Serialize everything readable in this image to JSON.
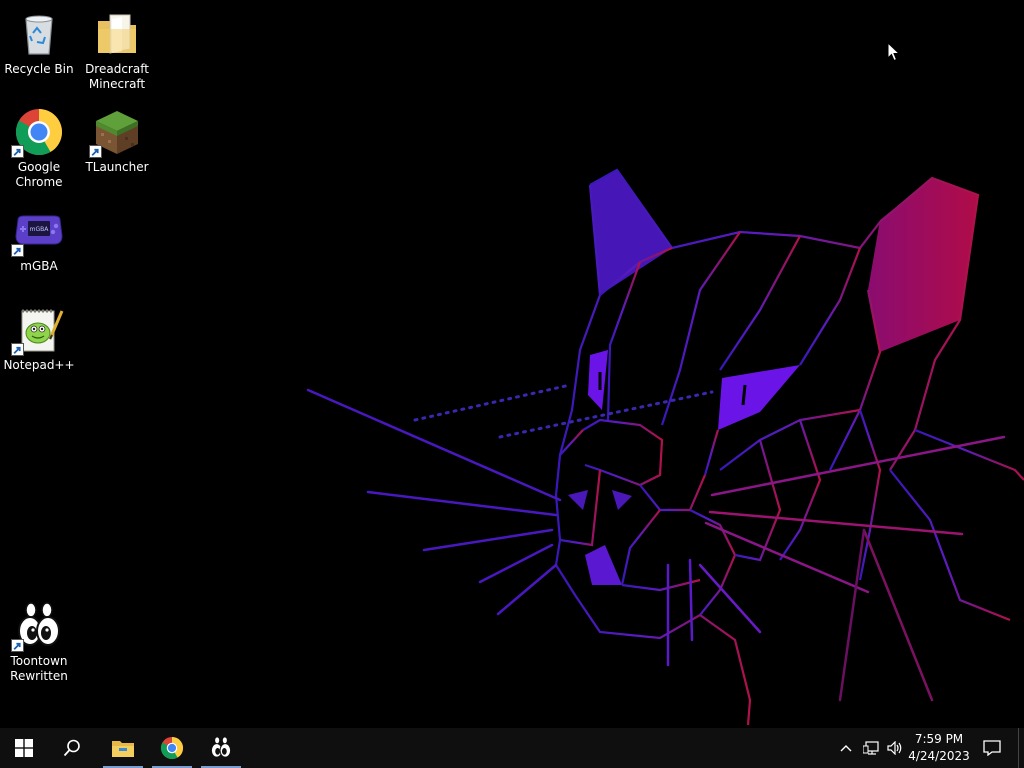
{
  "desktop": {
    "icons": [
      {
        "label": "Recycle Bin",
        "icon": "recycle-bin-icon",
        "shortcut": false
      },
      {
        "label": "Dreadcraft\nMinecraft",
        "icon": "folder-icon",
        "shortcut": false
      },
      {
        "label": "Google\nChrome",
        "icon": "chrome-icon",
        "shortcut": true
      },
      {
        "label": "TLauncher",
        "icon": "grass-block-icon",
        "shortcut": true
      },
      {
        "label": "mGBA",
        "icon": "gameboy-advance-icon",
        "shortcut": true
      },
      {
        "label": "Notepad++",
        "icon": "notepad-plus-plus-icon",
        "shortcut": true
      },
      {
        "label": "Toontown\nRewritten",
        "icon": "toontown-icon",
        "shortcut": true
      }
    ]
  },
  "taskbar": {
    "start": "windows-start-icon",
    "search": "search-icon",
    "pinned": [
      "file-explorer-icon",
      "chrome-icon",
      "toontown-icon"
    ],
    "tray": [
      "chevron-up-icon",
      "network-icon",
      "volume-icon"
    ],
    "time": "7:59 PM",
    "date": "4/24/2023",
    "notifications": "action-center-icon"
  },
  "colors": {
    "taskbar_bg": "#0f0f10",
    "active_underline": "#7a9ed0",
    "wallpaper_purple": "#6a1be0",
    "wallpaper_magenta": "#b0104a"
  }
}
